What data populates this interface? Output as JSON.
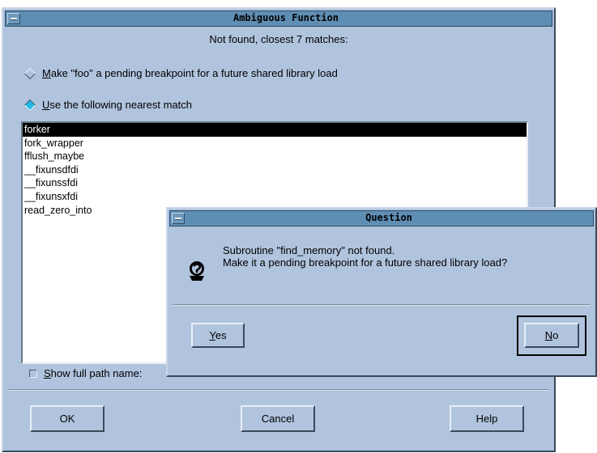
{
  "main_dialog": {
    "title": "Ambiguous Function",
    "subtitle": "Not found, closest 7 matches:",
    "radio_pending_label": "Make \"foo\" a pending breakpoint for a future shared library load",
    "radio_pending_mnemonic": "M",
    "radio_pending_rest": "ake \"foo\" a pending breakpoint for a future shared library load",
    "radio_nearest_mnemonic": "U",
    "radio_nearest_rest": "se the following nearest match",
    "matches": [
      "forker",
      "fork_wrapper",
      "fflush_maybe",
      "__fixunsdfdi",
      "__fixunssfdi",
      "__fixunsxfdi",
      "read_zero_into"
    ],
    "selected_index": 0,
    "show_full_path_mnemonic": "S",
    "show_full_path_rest": "how full path name:",
    "buttons": {
      "ok": "OK",
      "cancel": "Cancel",
      "help": "Help"
    }
  },
  "question_dialog": {
    "title": "Question",
    "message_line1": "Subroutine \"find_memory\" not found.",
    "message_line2": "Make it a pending breakpoint for a future shared library load?",
    "yes_mnemonic": "Y",
    "yes_rest": "es",
    "no_mnemonic": "N",
    "no_rest": "o",
    "icon": "question-icon"
  },
  "colors": {
    "window_bg": "#b0c4de",
    "titlebar": "#5f8eb4",
    "radio_selected": "#22b8e8"
  }
}
